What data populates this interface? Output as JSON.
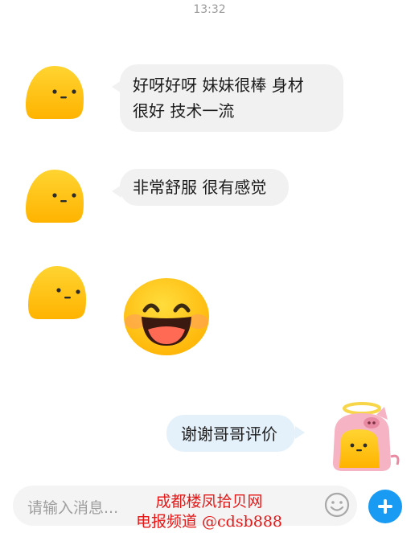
{
  "status": {
    "time": "13:32"
  },
  "messages": [
    {
      "direction": "incoming",
      "text_lines": [
        "好呀好呀 妹妹很棒 身材",
        "很好 技术一流"
      ],
      "avatar": "yellow-blob-icon"
    },
    {
      "direction": "incoming",
      "text_lines": [
        "非常舒服 很有感觉"
      ],
      "avatar": "yellow-blob-icon"
    },
    {
      "direction": "incoming",
      "sticker": "laughing-face-icon",
      "avatar": "yellow-blob-icon"
    },
    {
      "direction": "outgoing",
      "text_lines": [
        "谢谢哥哥评价"
      ],
      "avatar": "pig-hood-halo-avatar-icon"
    }
  ],
  "composer": {
    "placeholder": "请输入消息...",
    "emoji_icon": "smiley-icon",
    "plus_icon": "plus-icon"
  },
  "watermark": {
    "line1": "成都楼凤拾贝网",
    "line2": "电报频道 @cdsb888"
  },
  "colors": {
    "accent": "#1a9bf3",
    "incoming_bubble": "#f1f1f1",
    "outgoing_bubble": "#e4f1fb",
    "watermark": "#e51717"
  }
}
